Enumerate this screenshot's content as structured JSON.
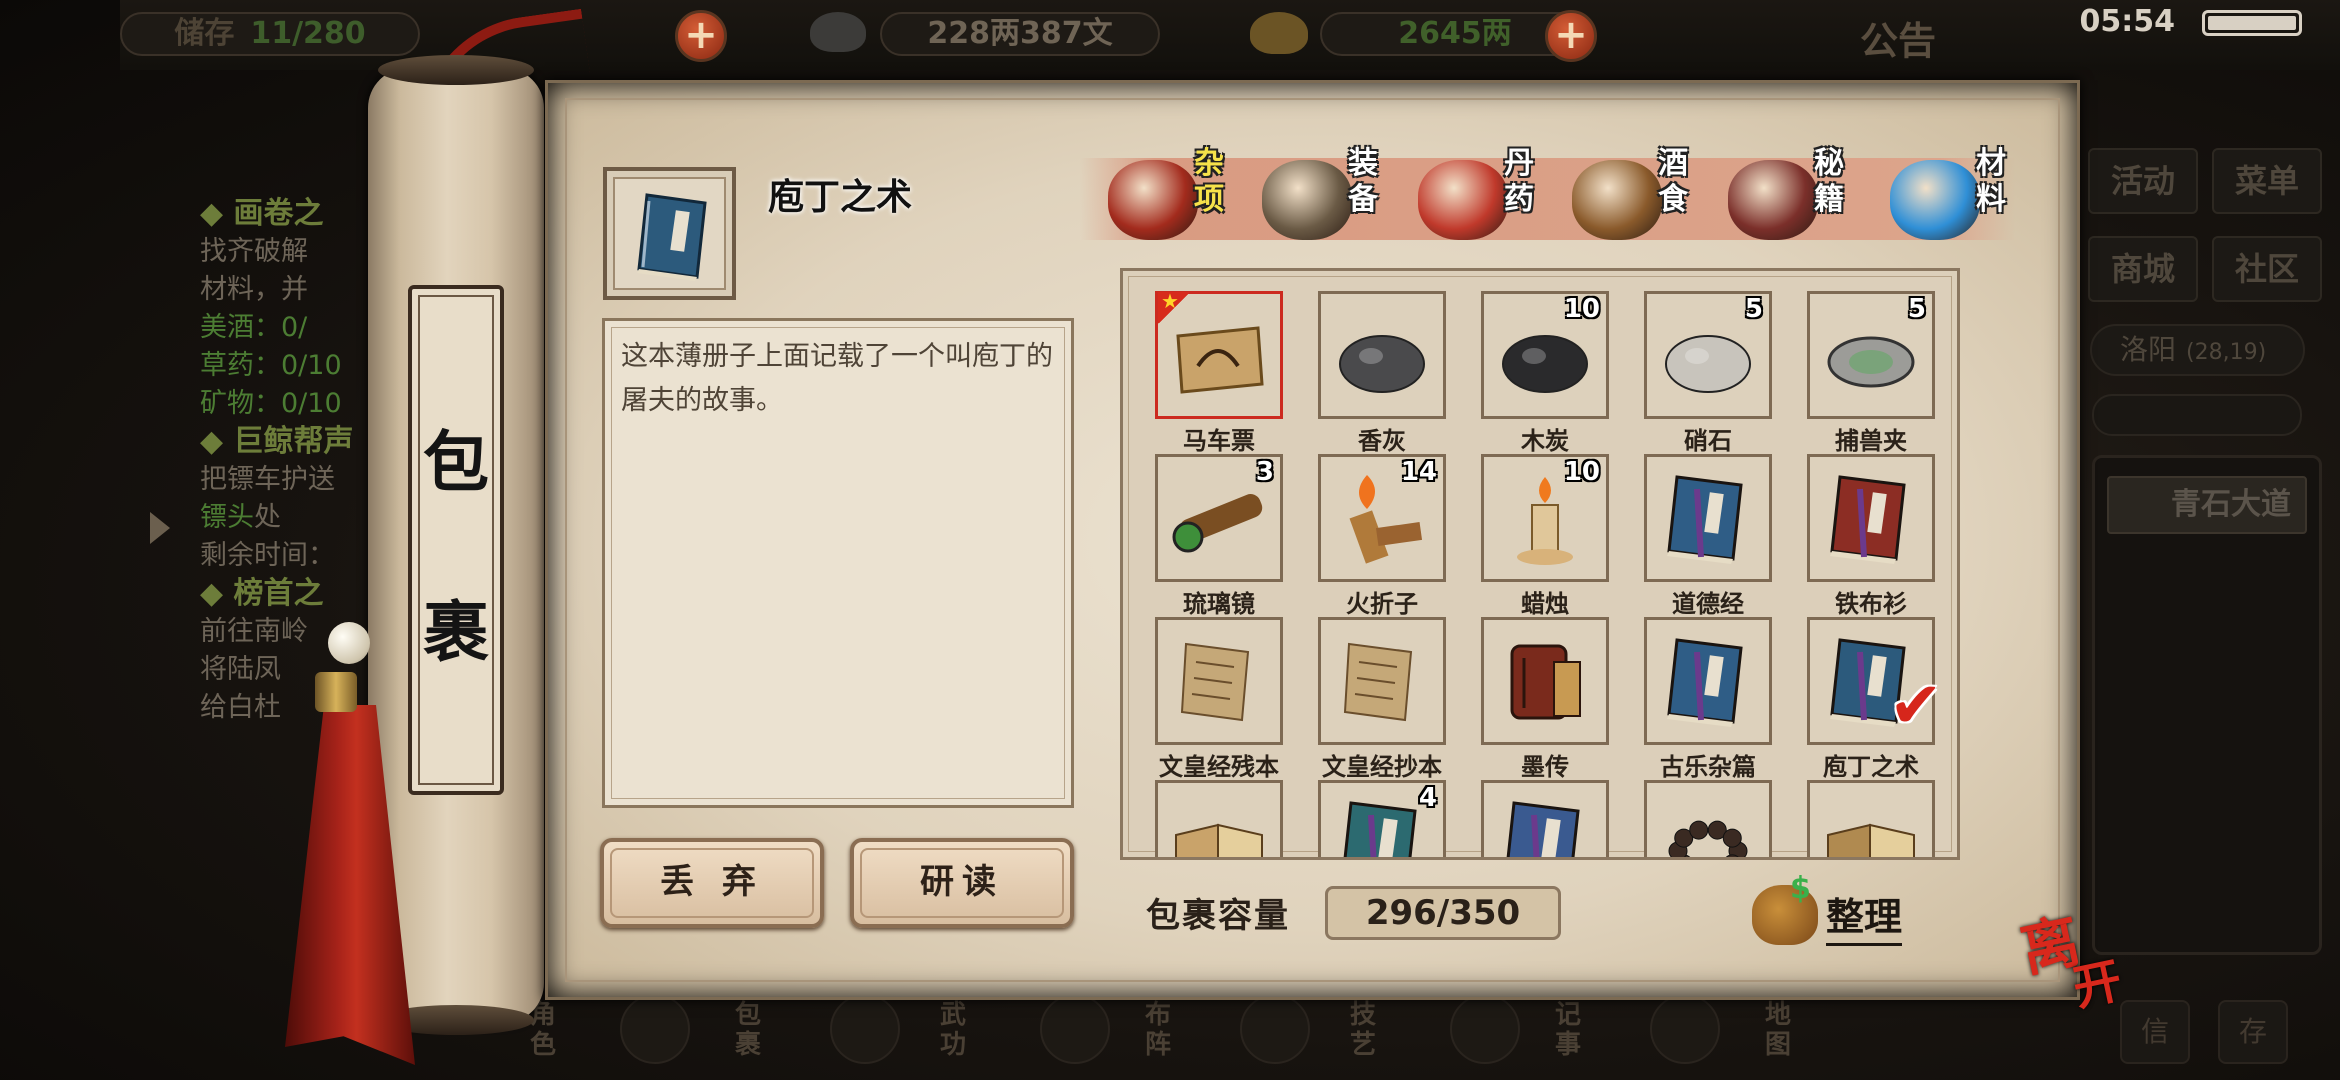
{
  "topbar": {
    "capacity": "11/280",
    "silver": "228两387文",
    "gold": "2645两",
    "notice": "公告",
    "time": "05:54",
    "left_label": "储存"
  },
  "left_quests": {
    "q1_title": "◆ 画卷之",
    "q1_l1": "找齐破解",
    "q1_l2": "材料，并",
    "q1_wine": "美酒：0/",
    "q1_herb": "草药：0/10",
    "q1_ore": "矿物：0/10",
    "q2_title": "◆ 巨鲸帮声",
    "q2_l1": "把镖车护送",
    "q2_l2a": "镖头",
    "q2_l2b": "处",
    "q2_l3": "剩余时间：",
    "q3_title": "◆ 榜首之",
    "q3_l1": "前往南岭",
    "q3_l2": "将陆凤",
    "q3_l3": "给白杜"
  },
  "right_menu": {
    "activity": "活动",
    "menu": "菜单",
    "mall": "商城",
    "community": "社区",
    "location": "洛阳",
    "coords": "(28,19)",
    "road": "青石大道",
    "extra1": "信",
    "extra2": "存"
  },
  "bottom_nav": [
    {
      "label": "角色"
    },
    {
      "label": "包裹"
    },
    {
      "label": "武功"
    },
    {
      "label": "布阵"
    },
    {
      "label": "技艺"
    },
    {
      "label": "记事"
    },
    {
      "label": "地图"
    }
  ],
  "scroll_title": [
    "包",
    "裹"
  ],
  "selected_item": {
    "name": "庖丁之术",
    "description": "这本薄册子上面记载了一个叫庖丁的屠夫的故事。"
  },
  "buttons": {
    "discard": "丢 弃",
    "study": "研读",
    "sort": "整理",
    "leave": "离开"
  },
  "categories": [
    {
      "label": "杂项",
      "active": true,
      "color": "#a32b1d"
    },
    {
      "label": "装备",
      "active": false,
      "color": "#6a5a45"
    },
    {
      "label": "丹药",
      "active": false,
      "color": "#c0392b"
    },
    {
      "label": "酒食",
      "active": false,
      "color": "#8a5a2b"
    },
    {
      "label": "秘籍",
      "active": false,
      "color": "#7b2f2a"
    },
    {
      "label": "材料",
      "active": false,
      "color": "#2f8fd6"
    }
  ],
  "items": [
    {
      "name": "马车票",
      "qty": "",
      "selected": true,
      "icon": "ticket-icon",
      "color": "#c9a36a"
    },
    {
      "name": "香灰",
      "qty": "",
      "icon": "ash-icon",
      "color": "#4a4a4c"
    },
    {
      "name": "木炭",
      "qty": "10",
      "icon": "charcoal-icon",
      "color": "#2a2a2c"
    },
    {
      "name": "硝石",
      "qty": "5",
      "icon": "saltpeter-icon",
      "color": "#c8c4bc"
    },
    {
      "name": "捕兽夹",
      "qty": "5",
      "icon": "trap-icon",
      "color": "#7aa37a"
    },
    {
      "name": "琉璃镜",
      "qty": "3",
      "icon": "telescope-icon",
      "color": "#7a4e22"
    },
    {
      "name": "火折子",
      "qty": "14",
      "icon": "torch-icon",
      "color": "#b07a3a"
    },
    {
      "name": "蜡烛",
      "qty": "10",
      "icon": "candle-icon",
      "color": "#e0c79a"
    },
    {
      "name": "道德经",
      "qty": "",
      "icon": "book-blue-icon",
      "color": "#2f5d86"
    },
    {
      "name": "铁布衫",
      "qty": "",
      "icon": "book-red-icon",
      "color": "#8c2d24"
    },
    {
      "name": "文皇经残本",
      "qty": "",
      "icon": "scroll-paper-icon",
      "color": "#c5a878"
    },
    {
      "name": "文皇经抄本",
      "qty": "",
      "icon": "scroll-paper-icon",
      "color": "#c5a878"
    },
    {
      "name": "墨传",
      "qty": "",
      "icon": "scroll-red-icon",
      "color": "#7a2a1c"
    },
    {
      "name": "古乐杂篇",
      "qty": "",
      "icon": "book-blue-icon",
      "color": "#2f5d86"
    },
    {
      "name": "庖丁之术",
      "qty": "",
      "checked": true,
      "icon": "book-blue-icon",
      "color": "#2c5a7c"
    },
    {
      "name": "",
      "qty": "",
      "icon": "open-book-icon",
      "color": "#c9a36a"
    },
    {
      "name": "",
      "qty": "4",
      "icon": "book-teal-icon",
      "color": "#2c6a70"
    },
    {
      "name": "",
      "qty": "",
      "icon": "book-blue-icon",
      "color": "#3a5a90"
    },
    {
      "name": "",
      "qty": "",
      "icon": "beads-icon",
      "color": "#3a2a22"
    },
    {
      "name": "",
      "qty": "",
      "icon": "open-book-icon",
      "color": "#b08a50"
    }
  ],
  "capacity": {
    "label": "包裹容量",
    "value": "296/350"
  }
}
